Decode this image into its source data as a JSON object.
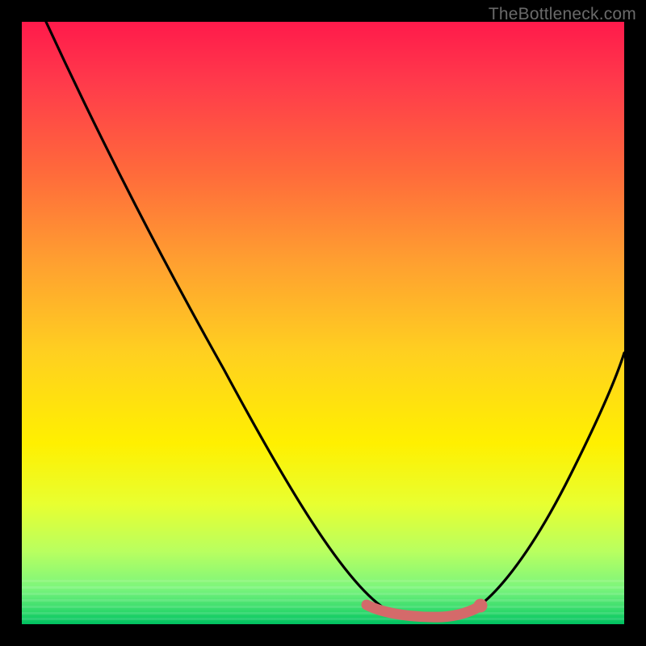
{
  "watermark": "TheBottleneck.com",
  "chart_data": {
    "type": "line",
    "title": "",
    "xlabel": "",
    "ylabel": "",
    "xlim": [
      0,
      100
    ],
    "ylim": [
      0,
      100
    ],
    "background_gradient": {
      "direction": "vertical",
      "stops": [
        {
          "pos": 0,
          "color": "#ff1a4b"
        },
        {
          "pos": 10,
          "color": "#ff3a4b"
        },
        {
          "pos": 25,
          "color": "#ff6a3b"
        },
        {
          "pos": 40,
          "color": "#ffa030"
        },
        {
          "pos": 55,
          "color": "#ffd020"
        },
        {
          "pos": 70,
          "color": "#fff000"
        },
        {
          "pos": 80,
          "color": "#e8ff30"
        },
        {
          "pos": 88,
          "color": "#b8ff60"
        },
        {
          "pos": 94,
          "color": "#7cf57c"
        },
        {
          "pos": 98,
          "color": "#2cd86a"
        },
        {
          "pos": 100,
          "color": "#00c060"
        }
      ]
    },
    "series": [
      {
        "name": "main-curve",
        "color": "#000000",
        "points": [
          {
            "x": 4,
            "y": 100
          },
          {
            "x": 12,
            "y": 83
          },
          {
            "x": 20,
            "y": 67
          },
          {
            "x": 28,
            "y": 52
          },
          {
            "x": 36,
            "y": 37
          },
          {
            "x": 44,
            "y": 23
          },
          {
            "x": 52,
            "y": 11
          },
          {
            "x": 58,
            "y": 4
          },
          {
            "x": 62,
            "y": 1.5
          },
          {
            "x": 67,
            "y": 1
          },
          {
            "x": 72,
            "y": 1.5
          },
          {
            "x": 76,
            "y": 3.5
          },
          {
            "x": 82,
            "y": 10
          },
          {
            "x": 88,
            "y": 20
          },
          {
            "x": 94,
            "y": 32
          },
          {
            "x": 100,
            "y": 45
          }
        ]
      },
      {
        "name": "highlight-band",
        "color": "#e06868",
        "points": [
          {
            "x": 57,
            "y": 3.5
          },
          {
            "x": 60,
            "y": 2.4
          },
          {
            "x": 64,
            "y": 1.8
          },
          {
            "x": 68,
            "y": 1.8
          },
          {
            "x": 72,
            "y": 2.2
          },
          {
            "x": 75,
            "y": 3.2
          }
        ],
        "end_marker": {
          "x": 75,
          "y": 3.2,
          "r": 1.0
        }
      }
    ]
  }
}
